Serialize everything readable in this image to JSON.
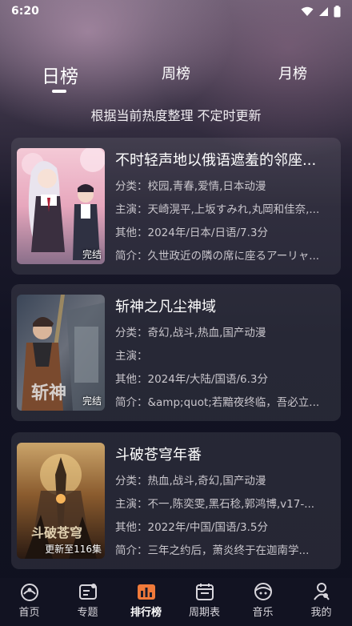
{
  "status_bar": {
    "time": "6:20"
  },
  "tabs": [
    {
      "label": "日榜",
      "active": true
    },
    {
      "label": "周榜",
      "active": false
    },
    {
      "label": "月榜",
      "active": false
    }
  ],
  "subtitle": "根据当前热度整理 不定时更新",
  "items": [
    {
      "title": "不时轻声地以俄语遮羞的邻座...",
      "category": "分类：校园,青春,爱情,日本动漫",
      "cast": "主演：天崎滉平,上坂すみれ,丸岡和佳奈,...",
      "other": "其他：2024年/日本/日语/7.3分",
      "intro": "简介：久世政近の隣の席に座るアーリャ...",
      "badge": "完结"
    },
    {
      "title": "斩神之凡尘神域",
      "category": "分类：奇幻,战斗,热血,国产动漫",
      "cast": "主演：",
      "other": "其他：2024年/大陆/国语/6.3分",
      "intro": "简介：&amp;quot;若黯夜终临，吾必立...",
      "badge": "完结"
    },
    {
      "title": "斗破苍穹年番",
      "category": "分类：热血,战斗,奇幻,国产动漫",
      "cast": "主演：不一,陈奕雯,黑石稔,郭鸿博,v17-...",
      "other": "其他：2022年/中国/国语/3.5分",
      "intro": "简介：三年之约后，萧炎终于在迦南学...",
      "badge": "更新至116集"
    }
  ],
  "nav": [
    {
      "label": "首页",
      "icon": "home-icon"
    },
    {
      "label": "专题",
      "icon": "topic-icon"
    },
    {
      "label": "排行榜",
      "icon": "ranking-icon",
      "active": true
    },
    {
      "label": "周期表",
      "icon": "calendar-icon"
    },
    {
      "label": "音乐",
      "icon": "music-icon"
    },
    {
      "label": "我的",
      "icon": "profile-icon"
    }
  ],
  "colors": {
    "accent": "#f07a3a",
    "background": "#10111f"
  }
}
